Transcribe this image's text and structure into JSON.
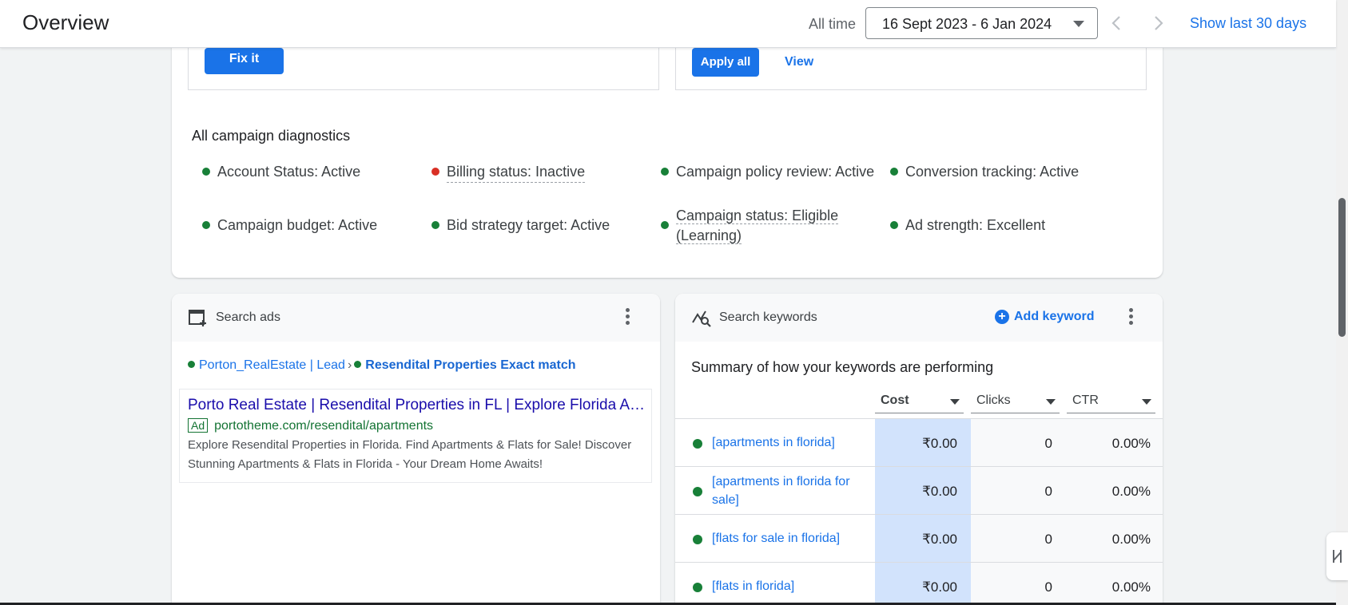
{
  "header": {
    "title": "Overview",
    "range_label": "All time",
    "date_range": "16 Sept 2023 - 6 Jan 2024",
    "show_last_label": "Show last 30 days"
  },
  "recommendations": {
    "fix_it_label": "Fix it",
    "apply_all_label": "Apply all",
    "view_label": "View"
  },
  "diagnostics": {
    "title": "All campaign diagnostics",
    "items": [
      {
        "label": "Account Status: Active",
        "status_color": "#188038"
      },
      {
        "label": "Billing status: Inactive",
        "status_color": "#d93025"
      },
      {
        "label": "Campaign policy review: Active",
        "status_color": "#188038"
      },
      {
        "label": "Conversion tracking: Active",
        "status_color": "#188038"
      },
      {
        "label": "Campaign budget: Active",
        "status_color": "#188038"
      },
      {
        "label": "Bid strategy target: Active",
        "status_color": "#188038"
      },
      {
        "label": "Campaign status: Eligible (Learning)",
        "status_color": "#188038"
      },
      {
        "label": "Ad strength: Excellent",
        "status_color": "#188038"
      }
    ]
  },
  "search_ads": {
    "title": "Search ads",
    "campaign": "Porton_RealEstate | Lead",
    "separator": "›",
    "ad_group": "Resendital Properties Exact match",
    "ad": {
      "headline": "Porto Real Estate | Resendital Properties in FL | Explore Florida A…",
      "badge": "Ad",
      "display_url": "portotheme.com/resendital/apartments",
      "description": "Explore Resendital Properties in Florida. Find Apartments & Flats for Sale! Discover Stunning Apartments & Flats in Florida - Your Dream Home Awaits!"
    }
  },
  "search_keywords": {
    "title": "Search keywords",
    "add_label": "Add keyword",
    "summary": "Summary of how your keywords are performing",
    "columns": [
      "Cost",
      "Clicks",
      "CTR"
    ],
    "rows": [
      {
        "keyword": "[apartments in florida]",
        "cost": "₹0.00",
        "clicks": "0",
        "ctr": "0.00%"
      },
      {
        "keyword": "[apartments in florida for sale]",
        "cost": "₹0.00",
        "clicks": "0",
        "ctr": "0.00%"
      },
      {
        "keyword": "[flats for sale in florida]",
        "cost": "₹0.00",
        "clicks": "0",
        "ctr": "0.00%"
      },
      {
        "keyword": "[flats in florida]",
        "cost": "₹0.00",
        "clicks": "0",
        "ctr": "0.00%"
      }
    ]
  },
  "colors": {
    "accent": "#1a73e8",
    "active": "#188038",
    "inactive": "#d93025",
    "cost_highlight": "#d2e3fc"
  }
}
